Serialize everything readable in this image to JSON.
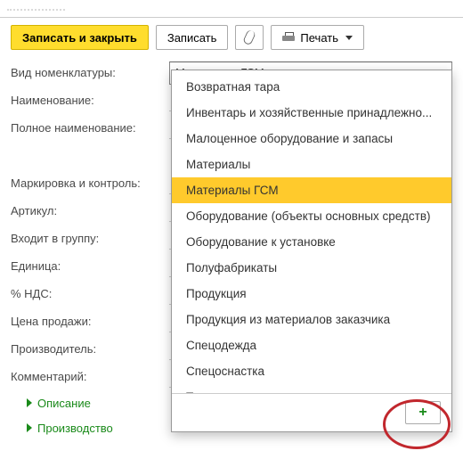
{
  "toolbar": {
    "save_close": "Записать и закрыть",
    "save": "Записать",
    "print": "Печать"
  },
  "fields": {
    "type_label": "Вид номенклатуры:",
    "type_value": "Материалы ГСМ",
    "name_label": "Наименование:",
    "fullname_label": "Полное наименование:",
    "marking_label": "Маркировка и контроль:",
    "article_label": "Артикул:",
    "group_label": "Входит в группу:",
    "unit_label": "Единица:",
    "vat_label": "% НДС:",
    "price_label": "Цена продажи:",
    "maker_label": "Производитель:",
    "comment_label": "Комментарий:"
  },
  "sub": {
    "desc": "Описание",
    "prod": "Производство"
  },
  "dropdown": [
    "Возвратная тара",
    "Инвентарь и хозяйственные принадлежно...",
    "Малоценное оборудование и запасы",
    "Материалы",
    "Материалы ГСМ",
    "Оборудование (объекты основных средств)",
    "Оборудование к установке",
    "Полуфабрикаты",
    "Продукция",
    "Продукция из материалов заказчика",
    "Спецодежда",
    "Спецоснастка",
    "Товары"
  ],
  "dropdown_selected": 4,
  "plus": "+"
}
